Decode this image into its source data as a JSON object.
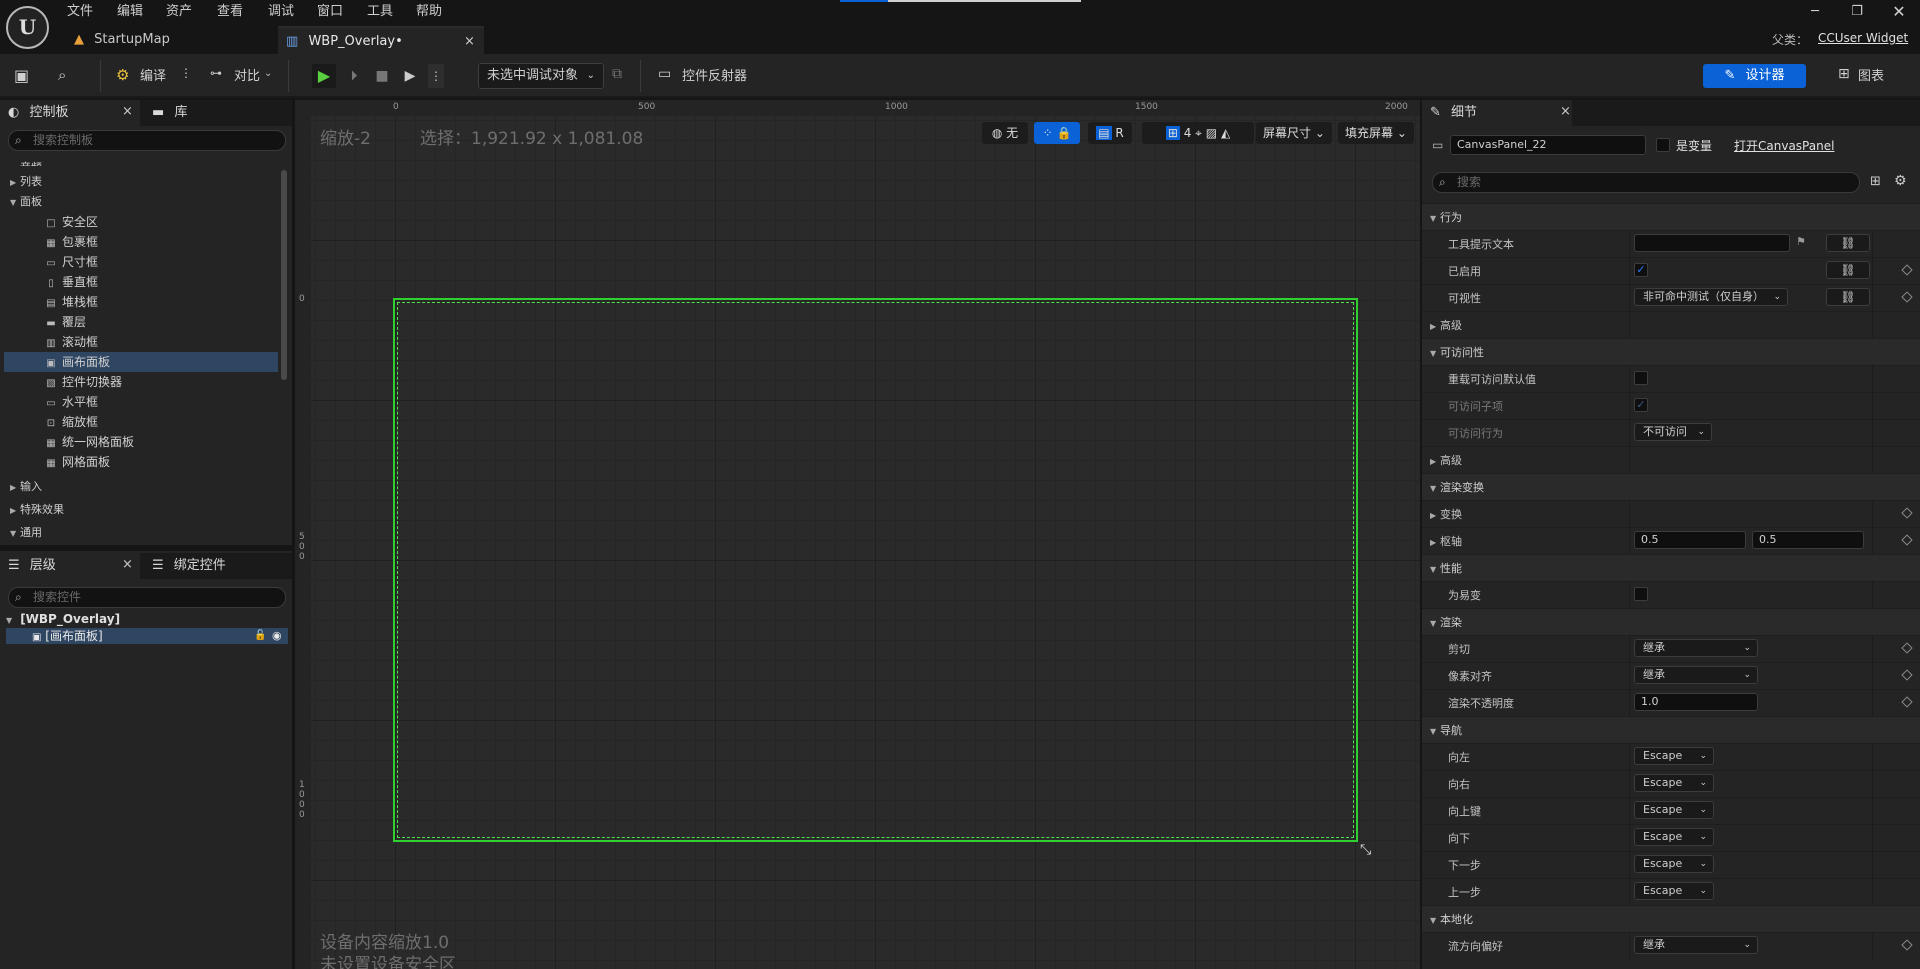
{
  "menu": [
    "文件",
    "编辑",
    "资产",
    "查看",
    "调试",
    "窗口",
    "工具",
    "帮助"
  ],
  "tabs": [
    {
      "label": "StartupMap"
    },
    {
      "label": "WBP_Overlay•"
    }
  ],
  "parent": {
    "label": "父类：",
    "value": "CCUser Widget"
  },
  "toolbar": {
    "compile": "编译",
    "compare": "对比",
    "debug_target": "未选中调试对象",
    "reflector": "控件反射器",
    "designer": "设计器",
    "graph": "图表"
  },
  "palette": {
    "tab": "控制板",
    "library_tab": "库",
    "search_placeholder": "搜索控制板",
    "rows": [
      {
        "type": "cat",
        "label": "音频"
      },
      {
        "type": "cat",
        "label": "列表"
      },
      {
        "type": "cat-open",
        "label": "面板"
      },
      {
        "type": "item",
        "label": "安全区",
        "sym": "□"
      },
      {
        "type": "item",
        "label": "包裹框",
        "sym": "▦"
      },
      {
        "type": "item",
        "label": "尺寸框",
        "sym": "▭"
      },
      {
        "type": "item",
        "label": "垂直框",
        "sym": "▯"
      },
      {
        "type": "item",
        "label": "堆栈框",
        "sym": "▤"
      },
      {
        "type": "item",
        "label": "覆层",
        "sym": "▬"
      },
      {
        "type": "item",
        "label": "滚动框",
        "sym": "▥"
      },
      {
        "type": "item-sel",
        "label": "画布面板",
        "sym": "▣"
      },
      {
        "type": "item",
        "label": "控件切换器",
        "sym": "▧"
      },
      {
        "type": "item",
        "label": "水平框",
        "sym": "▭"
      },
      {
        "type": "item",
        "label": "缩放框",
        "sym": "⊡"
      },
      {
        "type": "item",
        "label": "统一网格面板",
        "sym": "▦"
      },
      {
        "type": "item",
        "label": "网格面板",
        "sym": "▦"
      },
      {
        "type": "cat",
        "label": "输入"
      },
      {
        "type": "cat",
        "label": "特殊效果"
      },
      {
        "type": "cat-open",
        "label": "通用"
      }
    ]
  },
  "hierarchy": {
    "tab": "层级",
    "bind_tab": "绑定控件",
    "search_placeholder": "搜索控件",
    "root": "[WBP_Overlay]",
    "child": "[画布面板]"
  },
  "canvas": {
    "zoom": "缩放-2",
    "selection": "选择：1,921.92 x 1,081.08",
    "none": "无",
    "r": "R",
    "grid_num": "4",
    "screen_size": "屏幕尺寸",
    "fill_screen": "填充屏幕",
    "dpi": "设备内容缩放1.0",
    "safe_zone": "未设置设备安全区",
    "ruler_top": [
      "0",
      "500",
      "1000",
      "1500",
      "2000"
    ],
    "ruler_left": [
      "0",
      "5\n0\n0",
      "1\n0\n0\n0"
    ]
  },
  "details": {
    "tab": "细节",
    "name": "CanvasPanel_22",
    "is_variable": "是变量",
    "open_link": "打开CanvasPanel",
    "search_placeholder": "搜索",
    "rows": [
      {
        "kind": "cat",
        "label": "行为"
      },
      {
        "kind": "prop",
        "label": "工具提示文本",
        "input": "",
        "flag": true,
        "link": true
      },
      {
        "kind": "prop",
        "label": "已启用",
        "check": true,
        "link": true,
        "diamond": true
      },
      {
        "kind": "prop",
        "label": "可视性",
        "dropdown": "非可命中测试（仅自身）",
        "link": true,
        "diamond": true
      },
      {
        "kind": "sub",
        "label": "高级"
      },
      {
        "kind": "cat",
        "label": "可访问性"
      },
      {
        "kind": "prop",
        "label": "重载可访问默认值",
        "check": false
      },
      {
        "kind": "prop-dim",
        "label": "可访问子项",
        "check": true
      },
      {
        "kind": "prop-dim",
        "label": "可访问行为",
        "dropdown": "不可访问"
      },
      {
        "kind": "sub",
        "label": "高级"
      },
      {
        "kind": "cat",
        "label": "渲染变换"
      },
      {
        "kind": "sub",
        "label": "变换",
        "diamond": true
      },
      {
        "kind": "sub",
        "label": "枢轴",
        "pair": [
          "0.5",
          "0.5"
        ],
        "diamond": true
      },
      {
        "kind": "cat",
        "label": "性能"
      },
      {
        "kind": "prop",
        "label": "为易变",
        "check": false
      },
      {
        "kind": "cat",
        "label": "渲染"
      },
      {
        "kind": "prop",
        "label": "剪切",
        "dropdown": "继承",
        "diamond": true
      },
      {
        "kind": "prop",
        "label": "像素对齐",
        "dropdown": "继承",
        "diamond": true
      },
      {
        "kind": "prop",
        "label": "渲染不透明度",
        "input": "1.0",
        "diamond": true
      },
      {
        "kind": "cat",
        "label": "导航"
      },
      {
        "kind": "prop",
        "label": "向左",
        "dropdown_s": "Escape"
      },
      {
        "kind": "prop",
        "label": "向右",
        "dropdown_s": "Escape"
      },
      {
        "kind": "prop",
        "label": "向上键",
        "dropdown_s": "Escape"
      },
      {
        "kind": "prop",
        "label": "向下",
        "dropdown_s": "Escape"
      },
      {
        "kind": "prop",
        "label": "下一步",
        "dropdown_s": "Escape"
      },
      {
        "kind": "prop",
        "label": "上一步",
        "dropdown_s": "Escape"
      },
      {
        "kind": "cat",
        "label": "本地化"
      },
      {
        "kind": "prop",
        "label": "流方向偏好",
        "dropdown": "继承",
        "diamond": true
      }
    ]
  },
  "colors": {
    "accent": "#0a62d6",
    "selection_border": "#30d030",
    "selected_row": "#2f4663"
  }
}
